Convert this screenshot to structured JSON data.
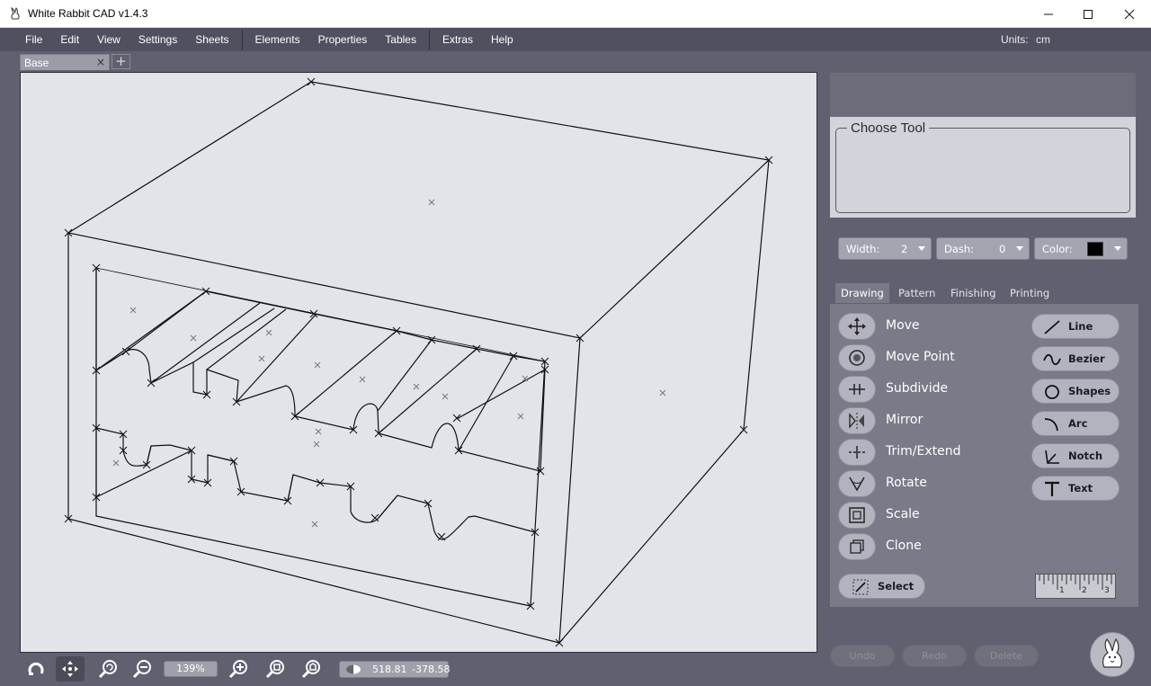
{
  "window": {
    "title": "White Rabbit CAD v1.4.3",
    "controls": [
      "minimize-icon",
      "maximize-icon",
      "close-icon"
    ]
  },
  "menubar": {
    "file": "File",
    "edit": "Edit",
    "view": "View",
    "settings": "Settings",
    "sheets": "Sheets",
    "elements": "Elements",
    "properties": "Properties",
    "tables": "Tables",
    "extras": "Extras",
    "help": "Help",
    "units_label": "Units:",
    "units_value": "cm"
  },
  "tabs": {
    "active_tab": "Base",
    "close_glyph": "×",
    "add_glyph": "+"
  },
  "bottom_bar": {
    "zoom_value": "139%",
    "coord_x": "518.81",
    "coord_y": "-378.58",
    "icons": [
      "magnet-icon",
      "pan-icon",
      "zoom-refresh-icon",
      "zoom-out-icon",
      "zoom-in-icon",
      "zoom-fit-icon",
      "zoom-page-icon"
    ]
  },
  "tool_panel": {
    "choose_tool_legend": "Choose Tool",
    "width_label": "Width:",
    "width_value": "2",
    "dash_label": "Dash:",
    "dash_value": "0",
    "color_label": "Color:",
    "color_value": "#000000"
  },
  "panel_tabs": {
    "drawing": "Drawing",
    "pattern": "Pattern",
    "finishing": "Finishing",
    "printing": "Printing"
  },
  "drawing_tools": {
    "move": "Move",
    "move_point": "Move Point",
    "subdivide": "Subdivide",
    "mirror": "Mirror",
    "trim_extend": "Trim/Extend",
    "rotate": "Rotate",
    "scale": "Scale",
    "clone": "Clone",
    "select": "Select"
  },
  "shape_tools": {
    "line": "Line",
    "bezier": "Bezier",
    "shapes": "Shapes",
    "arc": "Arc",
    "notch": "Notch",
    "text": "Text"
  },
  "ruler_numbers": {
    "n1": "1",
    "n2": "2",
    "n3": "3"
  },
  "history": {
    "undo": "Undo",
    "redo": "Redo",
    "delete": "Delete"
  },
  "colors": {
    "background": "#5f6170",
    "menubar": "#4f5160",
    "canvas": "#e3e4ea",
    "panel": "#7a7b88",
    "button": "#b2b3be"
  }
}
